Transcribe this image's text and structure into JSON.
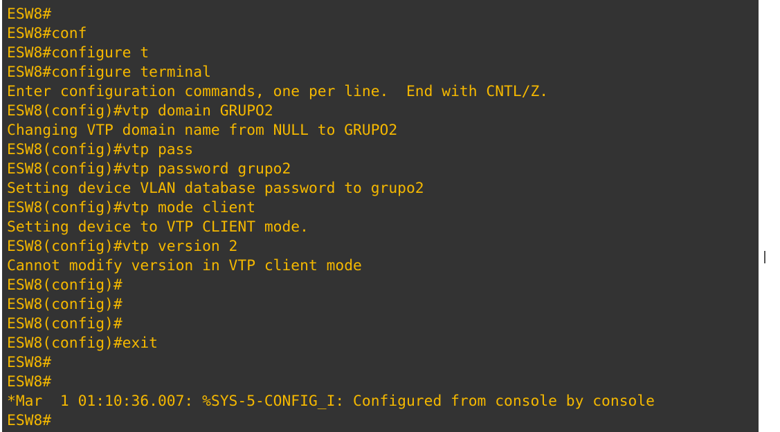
{
  "terminal": {
    "text_color": "#f5b800",
    "background_color": "#333333",
    "lines": [
      "ESW8#",
      "ESW8#conf",
      "ESW8#configure t",
      "ESW8#configure terminal",
      "Enter configuration commands, one per line.  End with CNTL/Z.",
      "ESW8(config)#vtp domain GRUPO2",
      "Changing VTP domain name from NULL to GRUPO2",
      "ESW8(config)#vtp pass",
      "ESW8(config)#vtp password grupo2",
      "Setting device VLAN database password to grupo2",
      "ESW8(config)#vtp mode client",
      "Setting device to VTP CLIENT mode.",
      "ESW8(config)#vtp version 2",
      "Cannot modify version in VTP client mode",
      "ESW8(config)#",
      "ESW8(config)#",
      "ESW8(config)#",
      "ESW8(config)#exit",
      "ESW8#",
      "ESW8#",
      "*Mar  1 01:10:36.007: %SYS-5-CONFIG_I: Configured from console by console",
      "ESW8#"
    ]
  }
}
